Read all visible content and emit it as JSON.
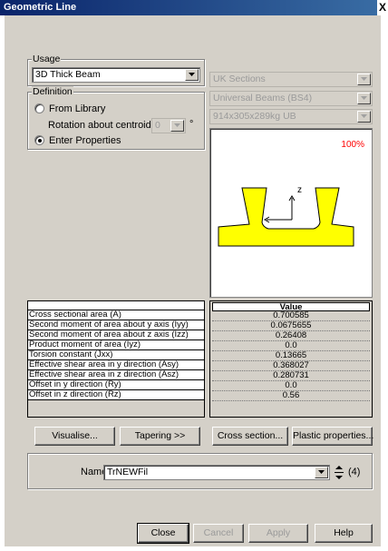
{
  "window": {
    "title": "Geometric Line",
    "close_glyph": "X"
  },
  "usage": {
    "legend": "Usage",
    "selected": "3D Thick Beam"
  },
  "definition": {
    "legend": "Definition",
    "from_library_label": "From Library",
    "rotation_label": "Rotation about centroid",
    "rotation_value": "0",
    "rotation_unit": "°",
    "enter_properties_label": "Enter Properties",
    "selected_option": "Enter Properties"
  },
  "library": {
    "section_type": "UK Sections",
    "section_family": "Universal Beams (BS4)",
    "section_size": "914x305x289kg UB"
  },
  "preview": {
    "zoom": "100%",
    "axis_label": "z"
  },
  "properties": {
    "value_header": "Value",
    "rows": [
      {
        "label": "Cross sectional area (A)",
        "value": "0.700585"
      },
      {
        "label": "Second moment of area about y axis (Iyy)",
        "value": "0.0675655"
      },
      {
        "label": "Second moment of area about z axis (Izz)",
        "value": "0.26408"
      },
      {
        "label": "Product moment of area (Iyz)",
        "value": "0.0"
      },
      {
        "label": "Torsion constant (Jxx)",
        "value": "0.13665"
      },
      {
        "label": "Effective shear area in y direction (Asy)",
        "value": "0.368027"
      },
      {
        "label": "Effective shear area in z direction (Asz)",
        "value": "0.280731"
      },
      {
        "label": "Offset in y direction (Ry)",
        "value": "0.0"
      },
      {
        "label": "Offset in z direction (Rz)",
        "value": "0.56"
      }
    ]
  },
  "buttons": {
    "visualise": "Visualise...",
    "tapering": "Tapering >>",
    "cross_section": "Cross section...",
    "plastic_properties": "Plastic properties...",
    "close": "Close",
    "cancel": "Cancel",
    "apply": "Apply",
    "help": "Help"
  },
  "name_field": {
    "label": "Name",
    "value": "TrNEWFil",
    "count": "(4)"
  },
  "colors": {
    "section_fill": "#ffff00",
    "zoom_text": "#ff0000",
    "dialog_bg": "#d4d0c8"
  }
}
